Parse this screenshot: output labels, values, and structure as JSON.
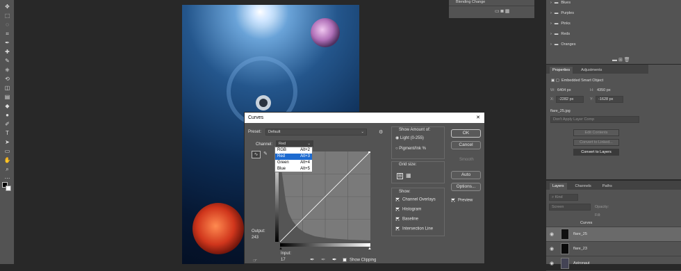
{
  "toolbar": {
    "icons": [
      "move-icon",
      "artboard-icon",
      "lasso-icon",
      "crop-icon",
      "eyedropper-icon",
      "healing-brush-icon",
      "brush-icon",
      "clone-stamp-icon",
      "history-brush-icon",
      "eraser-icon",
      "gradient-icon",
      "blur-icon",
      "dodge-icon",
      "pen-icon",
      "type-icon",
      "path-select-icon",
      "rectangle-icon",
      "hand-icon",
      "zoom-icon",
      "more-tools-icon"
    ]
  },
  "history": {
    "item": "Blending Change"
  },
  "swatches": {
    "groups": [
      "Blues",
      "Purples",
      "Pinks",
      "Reds",
      "Oranges"
    ]
  },
  "properties": {
    "tabs": [
      "Properties",
      "Adjustments"
    ],
    "type": "Embedded Smart Object",
    "w_label": "W:",
    "w": "6404 px",
    "h_label": "H:",
    "h": "4350 px",
    "x_label": "X:",
    "x": "-2282 px",
    "y_label": "Y:",
    "y": "-1628 px",
    "file": "flare_25.jpg",
    "layer_comp": "Don't Apply Layer Comp",
    "btn_edit": "Edit Contents",
    "btn_linked": "Convert to Linked...",
    "btn_layers": "Convert to Layers"
  },
  "layers": {
    "tabs": [
      "Layers",
      "Channels",
      "Paths"
    ],
    "kind": "Kind",
    "blend": "Screen",
    "opacity": "Opacity:",
    "fill": "Fill:",
    "rows": [
      "Curves",
      "flare_25",
      "flare_23",
      "Astronaut"
    ]
  },
  "curves": {
    "title": "Curves",
    "close": "✕",
    "preset_label": "Preset:",
    "preset_value": "Default",
    "channel_label": "Channel:",
    "channel_value": "Red",
    "channels": [
      {
        "name": "RGB",
        "key": "Alt+2"
      },
      {
        "name": "Red",
        "key": "Alt+3"
      },
      {
        "name": "Green",
        "key": "Alt+4"
      },
      {
        "name": "Blue",
        "key": "Alt+5"
      }
    ],
    "output_label": "Output:",
    "output_value": "243",
    "input_label": "Input:",
    "input_value": "17",
    "show_clipping": "Show Clipping",
    "show_amount": "Show Amount of:",
    "light": "Light  (0-255)",
    "pigment": "Pigment/Ink %",
    "grid_size": "Grid size:",
    "show": "Show:",
    "options": [
      "Channel Overlays",
      "Histogram",
      "Baseline",
      "Intersection Line"
    ],
    "ok": "OK",
    "cancel": "Cancel",
    "smooth": "Smooth",
    "auto": "Auto",
    "options_btn": "Options...",
    "preview": "Preview"
  }
}
